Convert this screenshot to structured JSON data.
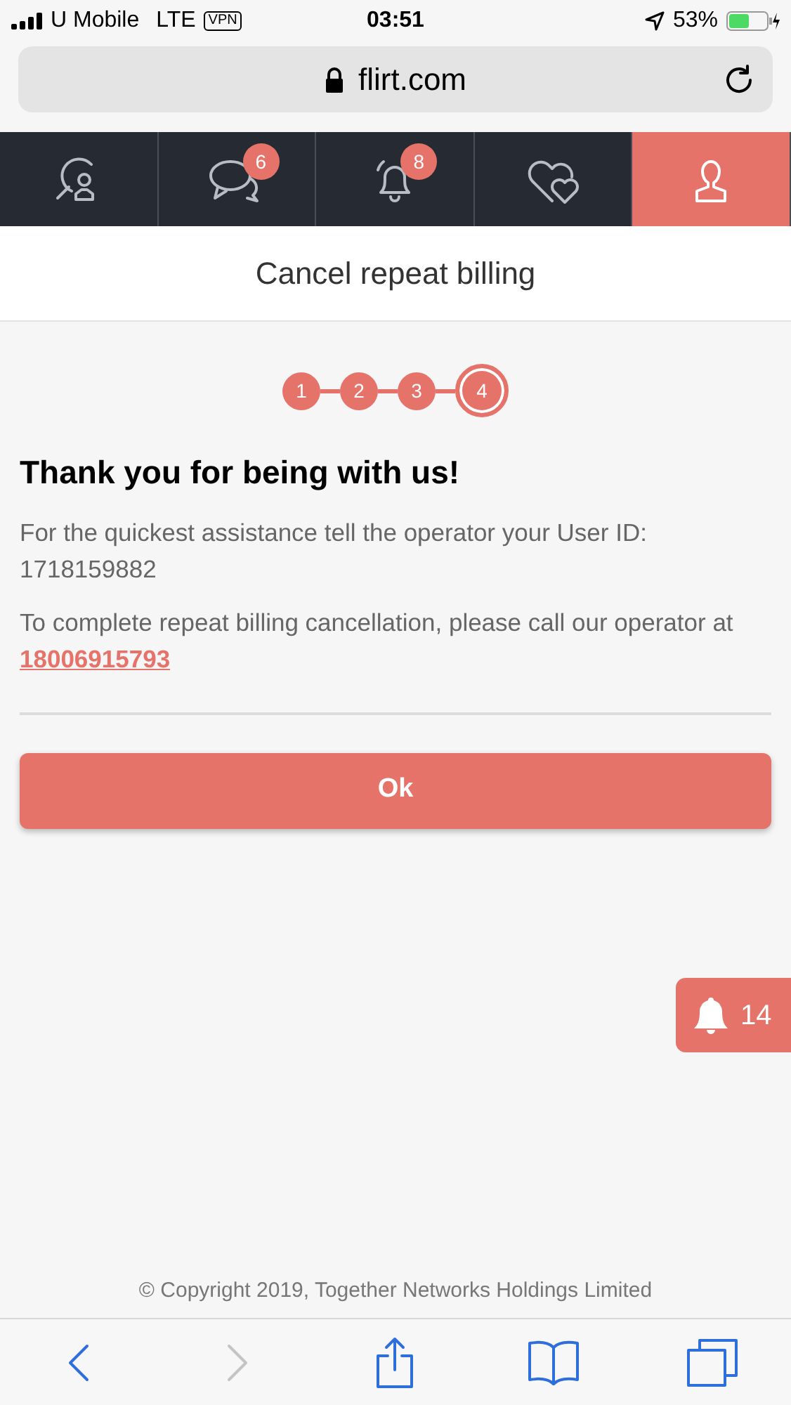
{
  "status_bar": {
    "carrier": "U Mobile",
    "network": "LTE",
    "vpn": "VPN",
    "time": "03:51",
    "battery": "53%"
  },
  "address_bar": {
    "url": "flirt.com"
  },
  "tabs": [
    {
      "kind": "search",
      "selected": false
    },
    {
      "kind": "messages",
      "badge": "6",
      "selected": false
    },
    {
      "kind": "notifications",
      "badge": "8",
      "selected": false
    },
    {
      "kind": "likes",
      "selected": false
    },
    {
      "kind": "profile",
      "selected": true
    }
  ],
  "page_title": "Cancel repeat billing",
  "steps": [
    {
      "label": "1",
      "selected": false
    },
    {
      "label": "2",
      "selected": false
    },
    {
      "label": "3",
      "selected": false
    },
    {
      "label": "4",
      "selected": true
    }
  ],
  "heading": "Thank you for being with us!",
  "user_id_text": "For the quickest assistance tell the operator your User ID: 1718159882",
  "call_text": "To complete repeat billing cancellation, please call our operator at",
  "phone_link": "18006915793",
  "ok_button": "Ok",
  "notification_count": "14",
  "copyright": "© Copyright 2019, Together Networks Holdings Limited",
  "toolbar": [
    {
      "kind": "back",
      "disabled": false
    },
    {
      "kind": "forward",
      "disabled": true
    },
    {
      "kind": "share",
      "disabled": false
    },
    {
      "kind": "bookmarks",
      "disabled": false
    },
    {
      "kind": "tabs",
      "disabled": false
    }
  ]
}
